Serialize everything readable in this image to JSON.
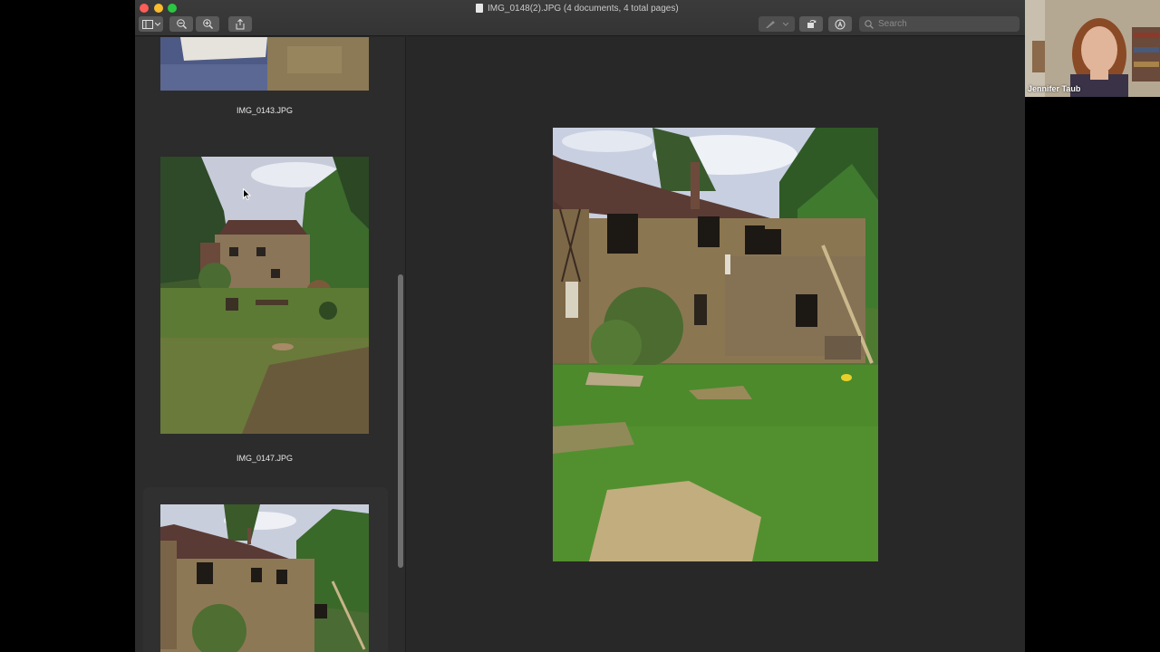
{
  "window": {
    "title": "IMG_0148(2).JPG (4 documents, 4 total pages)",
    "search_placeholder": "Search"
  },
  "sidebar": {
    "items": [
      {
        "label": "IMG_0143.JPG"
      },
      {
        "label": "IMG_0147.JPG"
      },
      {
        "label": ""
      }
    ]
  },
  "video": {
    "participant_name": "Jennifer Taub"
  },
  "colors": {
    "close": "#fd5e57",
    "minimize": "#fdbb2e",
    "maximize": "#2ac741",
    "window_bg": "#282828",
    "sidebar_bg": "#2c2c2c"
  },
  "icons": [
    "sidebar-toggle-icon",
    "chevron-down-icon",
    "zoom-out-icon",
    "zoom-in-icon",
    "share-icon",
    "markup-pen-icon",
    "rotate-icon",
    "annotate-icon",
    "search-icon",
    "document-icon"
  ]
}
